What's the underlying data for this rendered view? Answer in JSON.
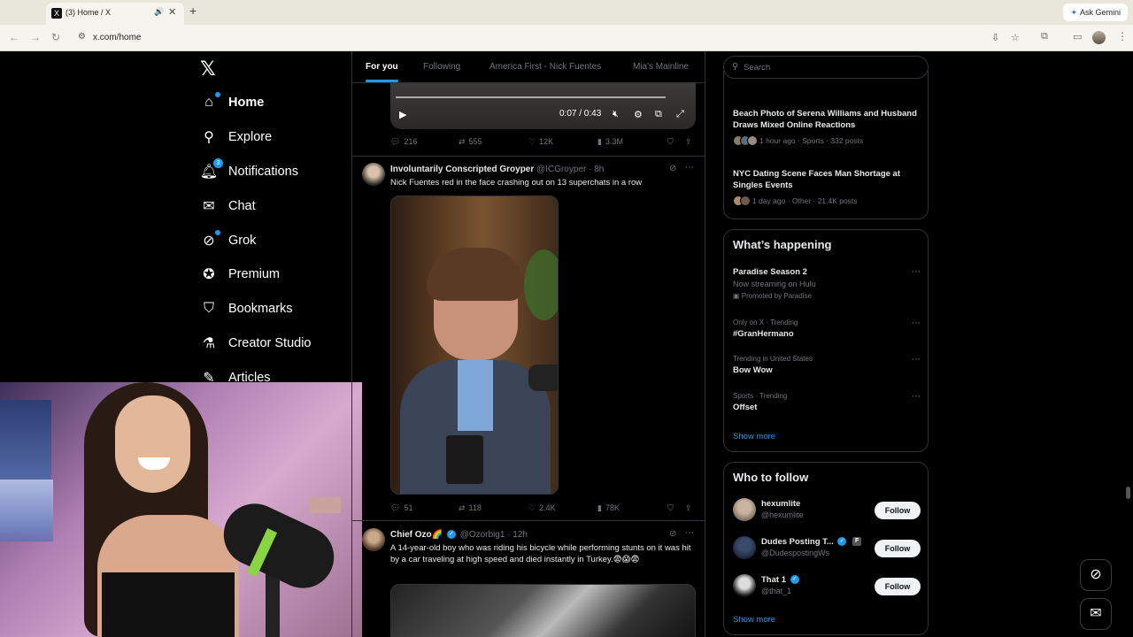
{
  "browser": {
    "tab_title": "(3) Home / X",
    "url": "x.com/home",
    "ask_gemini": "Ask Gemini"
  },
  "nav": {
    "logo": "𝕏",
    "notifications_badge": "3",
    "items": [
      {
        "label": "Home",
        "icon": "home-icon"
      },
      {
        "label": "Explore",
        "icon": "search-icon"
      },
      {
        "label": "Notifications",
        "icon": "bell-icon"
      },
      {
        "label": "Chat",
        "icon": "mail-icon"
      },
      {
        "label": "Grok",
        "icon": "grok-icon"
      },
      {
        "label": "Premium",
        "icon": "premium-icon"
      },
      {
        "label": "Bookmarks",
        "icon": "bookmark-icon"
      },
      {
        "label": "Creator Studio",
        "icon": "flask-icon"
      },
      {
        "label": "Articles",
        "icon": "article-icon"
      }
    ]
  },
  "feed": {
    "tabs": [
      "For you",
      "Following",
      "America First - Nick Fuentes",
      "Mia's Mainline"
    ],
    "video": {
      "time": "0:07 / 0:43"
    },
    "post0_stats": {
      "replies": "216",
      "reposts": "555",
      "likes": "12K",
      "views": "3.3M"
    },
    "post1": {
      "name": "Involuntarily Conscripted Groyper",
      "handle": "@ICGroyper",
      "time": "· 8h",
      "text": "Nick Fuentes red in the face crashing out on 13 superchats in a row",
      "stats": {
        "replies": "51",
        "reposts": "118",
        "likes": "2.4K",
        "views": "78K"
      }
    },
    "post2": {
      "name": "Chief Ozo🌈",
      "handle": "@Ozorbig1",
      "time": "· 12h",
      "text": "A 14-year-old boy who was riding his bicycle while performing stunts on it was hit by a car traveling at high speed and died instantly in Turkey.😨😱😨"
    }
  },
  "right": {
    "search_placeholder": "Search",
    "news": [
      {
        "title": "Beach Photo of Serena Williams and Husband Draws Mixed Online Reactions",
        "meta": "1 hour ago · Sports · 332 posts"
      },
      {
        "title": "NYC Dating Scene Faces Man Shortage at Singles Events",
        "meta": "1 day ago · Other · 21.4K posts"
      }
    ],
    "happening_title": "What’s happening",
    "trends": [
      {
        "context": "",
        "name": "Paradise Season 2",
        "sub": "Now streaming on Hulu",
        "promo": "Promoted by Paradise"
      },
      {
        "context": "Only on X · Trending",
        "name": "#GranHermano",
        "sub": "",
        "promo": ""
      },
      {
        "context": "Trending in United States",
        "name": "Bow Wow",
        "sub": "",
        "promo": ""
      },
      {
        "context": "Sports · Trending",
        "name": "Offset",
        "sub": "",
        "promo": ""
      }
    ],
    "show_more": "Show more",
    "who_title": "Who to follow",
    "follow": [
      {
        "name": "hexumlite",
        "handle": "@hexumlite",
        "button": "Follow"
      },
      {
        "name": "Dudes Posting T...",
        "handle": "@DudespostingWs",
        "button": "Follow"
      },
      {
        "name": "That 1",
        "handle": "@that_1",
        "button": "Follow"
      }
    ]
  },
  "colors": {
    "accent": "#1d9bf0",
    "bg": "#000000",
    "border": "#2f3336",
    "muted": "#71767b"
  }
}
